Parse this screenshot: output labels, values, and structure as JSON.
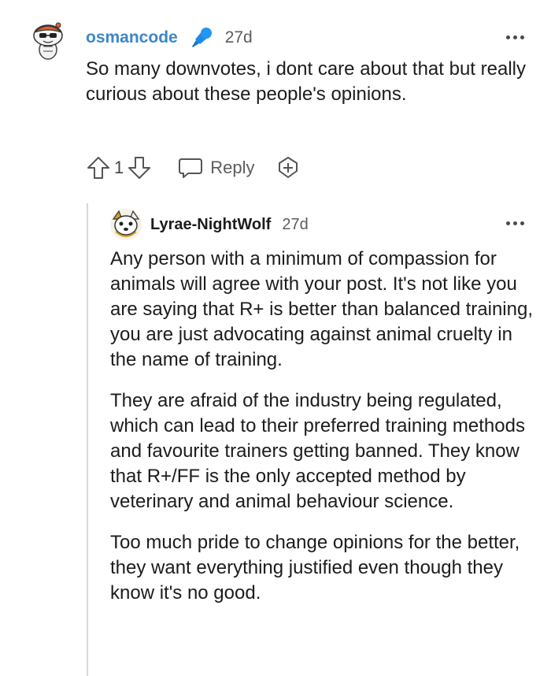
{
  "parent_comment": {
    "username": "osmancode",
    "flair_icon": "microphone-icon",
    "timestamp": "27d",
    "body": "So many downvotes, i dont care about that but really curious about these people's opinions.",
    "score": "1",
    "reply_label": "Reply"
  },
  "reply_comment": {
    "username": "Lyrae-NightWolf",
    "timestamp": "27d",
    "paragraphs": [
      "Any person with a minimum of compassion for animals will agree with your post. It's not like you are saying that R+ is better than balanced training, you are just advocating against animal cruelty in the name of training.",
      "They are afraid of the industry being regulated, which can lead to their preferred training methods and favourite trainers getting banned. They know that R+/FF is the only accepted method by veterinary and animal behaviour science.",
      "Too much pride to change opinions for the better, they want everything justified even though they know it's no good."
    ]
  },
  "colors": {
    "username_link": "#3d87c6",
    "mic_blue": "#1e88e5",
    "thread_line": "#d8d8d8"
  }
}
